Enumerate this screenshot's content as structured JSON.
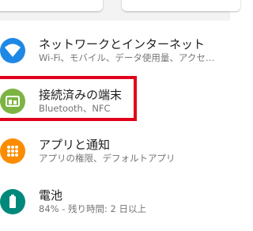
{
  "settings_list": {
    "items": [
      {
        "title": "ネットワークとインターネット",
        "subtitle": "Wi-Fi、モバイル、データ使用量、アクセ…",
        "icon": "wifi-icon",
        "icon_color": "#1e88e5"
      },
      {
        "title": "接続済みの端末",
        "subtitle": "Bluetooth、NFC",
        "icon": "connected-devices-icon",
        "icon_color": "#7cb342"
      },
      {
        "title": "アプリと通知",
        "subtitle": "アプリの権限、デフォルトアプリ",
        "icon": "apps-icon",
        "icon_color": "#fb8c00"
      },
      {
        "title": "電池",
        "subtitle": "84% - 残り時間: 2 日以上",
        "icon": "battery-icon",
        "icon_color": "#00897b"
      }
    ]
  },
  "highlight_color": "#e0001b"
}
